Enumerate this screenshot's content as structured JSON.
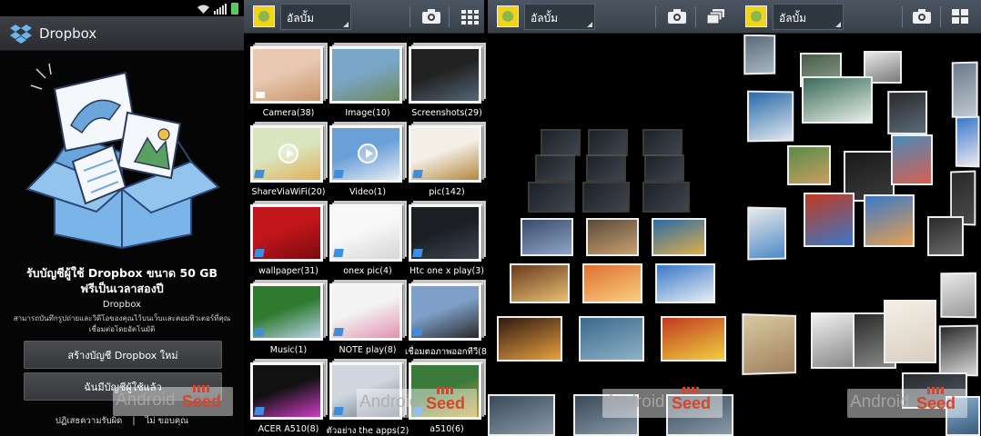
{
  "dropbox": {
    "app_title": "Dropbox",
    "headline_line1": "รับบัญชีผู้ใช้ Dropbox ขนาด 50 GB",
    "headline_line2": "ฟรีเป็นเวลาสองปี",
    "subtitle": "Dropbox",
    "description": "สามารถบันทึกรูปถ่ายและวิดีโอของคุณไว้บนเว็บและคอมพิวเตอร์ที่คุณเชื่อมต่อโดยอัตโนมัติ",
    "create_button": "สร้างบัญชี Dropbox ใหม่",
    "have_account_button": "ฉันมีบัญชีผู้ใช้แล้ว",
    "decline_link": "ปฏิเสธความรับผิด",
    "separator": "|",
    "no_thanks_link": "ไม่ ขอบคุณ"
  },
  "gallery": {
    "album_dropdown": "อัลบั้ม",
    "albums": [
      {
        "label": "Camera(38)",
        "colors": [
          "#e8c8b0",
          "#c9966c"
        ]
      },
      {
        "label": "Image(10)",
        "colors": [
          "#7aa6c8",
          "#6d8a5a"
        ]
      },
      {
        "label": "Screenshots(29)",
        "colors": [
          "#222222",
          "#556677"
        ]
      },
      {
        "label": "ShareViaWiFi(20)",
        "colors": [
          "#d8e6c0",
          "#e2b25a"
        ]
      },
      {
        "label": "Video(1)",
        "colors": [
          "#6aa0d8",
          "#e8eef4"
        ]
      },
      {
        "label": "pic(142)",
        "colors": [
          "#f4efe6",
          "#b4873c"
        ]
      },
      {
        "label": "wallpaper(31)",
        "colors": [
          "#c0161c",
          "#7a0a0e"
        ]
      },
      {
        "label": "onex pic(4)",
        "colors": [
          "#f8f8f8",
          "#d6d6d6"
        ]
      },
      {
        "label": "Htc one x play(3)",
        "colors": [
          "#1b1f24",
          "#3b4552"
        ]
      },
      {
        "label": "Music(1)",
        "colors": [
          "#2e7a2e",
          "#b7d2e8"
        ]
      },
      {
        "label": "NOTE play(8)",
        "colors": [
          "#f3f3f3",
          "#e291b0"
        ]
      },
      {
        "label": "เชื่อมตอภาพออกทีวี(8)",
        "colors": [
          "#7ea0c8",
          "#2a2a2a"
        ]
      },
      {
        "label": "ACER A510(8)",
        "colors": [
          "#111111",
          "#d23cc8"
        ]
      },
      {
        "label": "ตัวอย่าง the apps(2)",
        "colors": [
          "#cfd6de",
          "#6c7a88"
        ]
      },
      {
        "label": "a510(6)",
        "colors": [
          "#3a7a3a",
          "#c8a030"
        ]
      }
    ],
    "camera_icon": "camera-icon",
    "grid_view_icon": "grid-view-icon",
    "stack_view_icon": "stack-view-icon"
  },
  "grid3d_tiles": [
    {
      "colors": [
        "#3a4a6a",
        "#8ea7c8"
      ]
    },
    {
      "colors": [
        "#5a4a3a",
        "#c9a070"
      ]
    },
    {
      "colors": [
        "#2a6aa8",
        "#e0b04a"
      ]
    },
    {
      "colors": [
        "#6a3a20",
        "#e8c070"
      ]
    },
    {
      "colors": [
        "#e07030",
        "#f8d080"
      ]
    },
    {
      "colors": [
        "#3a78c8",
        "#e8eef4"
      ]
    },
    {
      "colors": [
        "#301a10",
        "#e8a040"
      ]
    },
    {
      "colors": [
        "#3a6a8a",
        "#8fb0c8"
      ]
    },
    {
      "colors": [
        "#c03a20",
        "#f0d040"
      ]
    }
  ],
  "watermark": {
    "brand_a": "Android",
    "brand_b": "Seed"
  }
}
